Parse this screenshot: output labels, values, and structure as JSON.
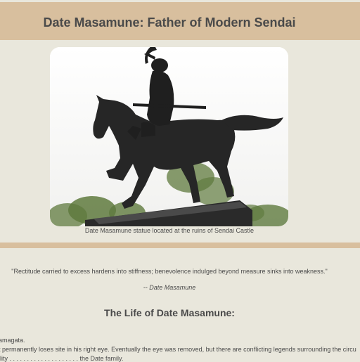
{
  "page": {
    "title": "Date Masamune: Father of Modern Sendai"
  },
  "figure": {
    "caption": "Date Masamune statue located at the ruins of Sendai Castle"
  },
  "quote": {
    "text": "\"Rectitude carried to excess hardens into stiffness; benevolence indulged beyond measure sinks into weakness.\"",
    "attribution": "-- Date Masamune"
  },
  "life": {
    "heading": "The Life of Date Masamune:",
    "lines": [
      "amagata.",
      "t permanently loses site in his right eye. Eventually the eye was removed, but there are conflicting legends surrounding the circu",
      "ility . . . . . . . . . . . . . . . . . . . . the Date family."
    ]
  },
  "colors": {
    "band": "#d8bf9e",
    "background": "#e9e7dc",
    "text": "#4a4a4a"
  }
}
